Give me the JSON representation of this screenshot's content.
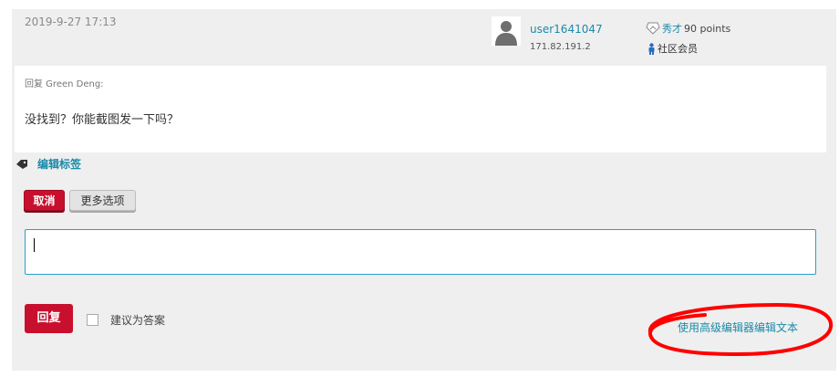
{
  "post": {
    "timestamp": "2019-9-27 17:13",
    "user": {
      "name": "user1641047",
      "ip": "171.82.191.2",
      "rank_name": "秀才",
      "points": "90 points",
      "role": "社区会员"
    },
    "reply_to": "回复 Green Deng:",
    "body": "没找到？你能截图发一下吗？"
  },
  "tags": {
    "edit_label": "编辑标签"
  },
  "actions": {
    "cancel_label": "取消",
    "more_options_label": "更多选项",
    "reply_label": "回复",
    "suggest_answer_label": "建议为答案",
    "advanced_editor_label": "使用高级编辑器编辑文本"
  },
  "reply_input": {
    "value": ""
  },
  "colors": {
    "accent": "#c8102e",
    "link": "#1a8aa8",
    "panel": "#efefef",
    "highlight_annotation": "#ff0000"
  },
  "icons": [
    "avatar-silhouette-icon",
    "rank-badge-icon",
    "member-person-icon",
    "tag-icon"
  ]
}
